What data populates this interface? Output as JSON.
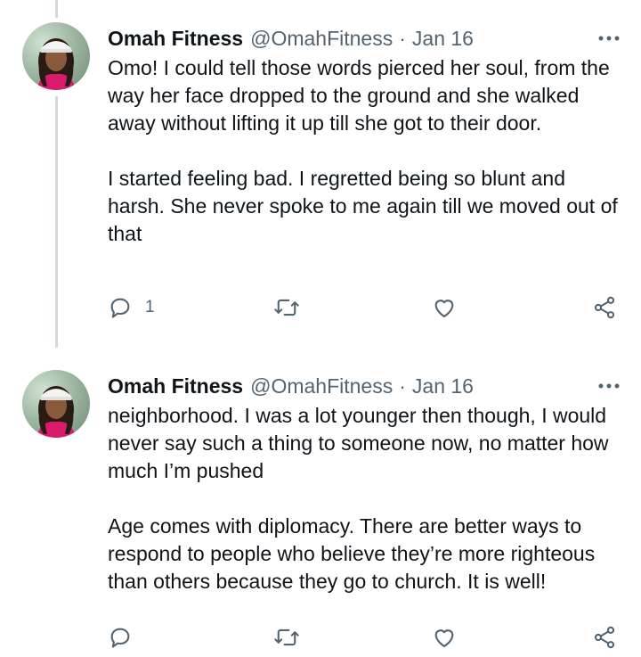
{
  "tweets": [
    {
      "name": "Omah Fitness",
      "handle": "@OmahFitness",
      "separator": "·",
      "date": "Jan 16",
      "paragraphs": [
        "Omo! I could tell those words pierced her soul, from the way her face dropped to the ground and she walked away without lifting it up till she got to their door.",
        "I started feeling bad. I regretted being so blunt and harsh. She never spoke to me again till we moved out of that"
      ],
      "reply_count": "1",
      "icons": [
        "more-icon",
        "reply-icon",
        "retweet-icon",
        "like-icon",
        "share-icon"
      ]
    },
    {
      "name": "Omah Fitness",
      "handle": "@OmahFitness",
      "separator": "·",
      "date": "Jan 16",
      "paragraphs": [
        "neighborhood. I was a lot younger then though, I would never say such a thing to someone now, no matter how much I’m pushed",
        "Age comes with diplomacy. There are better ways to respond to people who believe they’re more righteous than others because they go to church. It is well!"
      ],
      "reply_count": "",
      "icons": [
        "more-icon",
        "reply-icon",
        "retweet-icon",
        "like-icon",
        "share-icon"
      ]
    }
  ],
  "colors": {
    "text": "#0f1419",
    "secondary": "#536471",
    "thread_line": "#cfd9de",
    "background": "#ffffff"
  }
}
